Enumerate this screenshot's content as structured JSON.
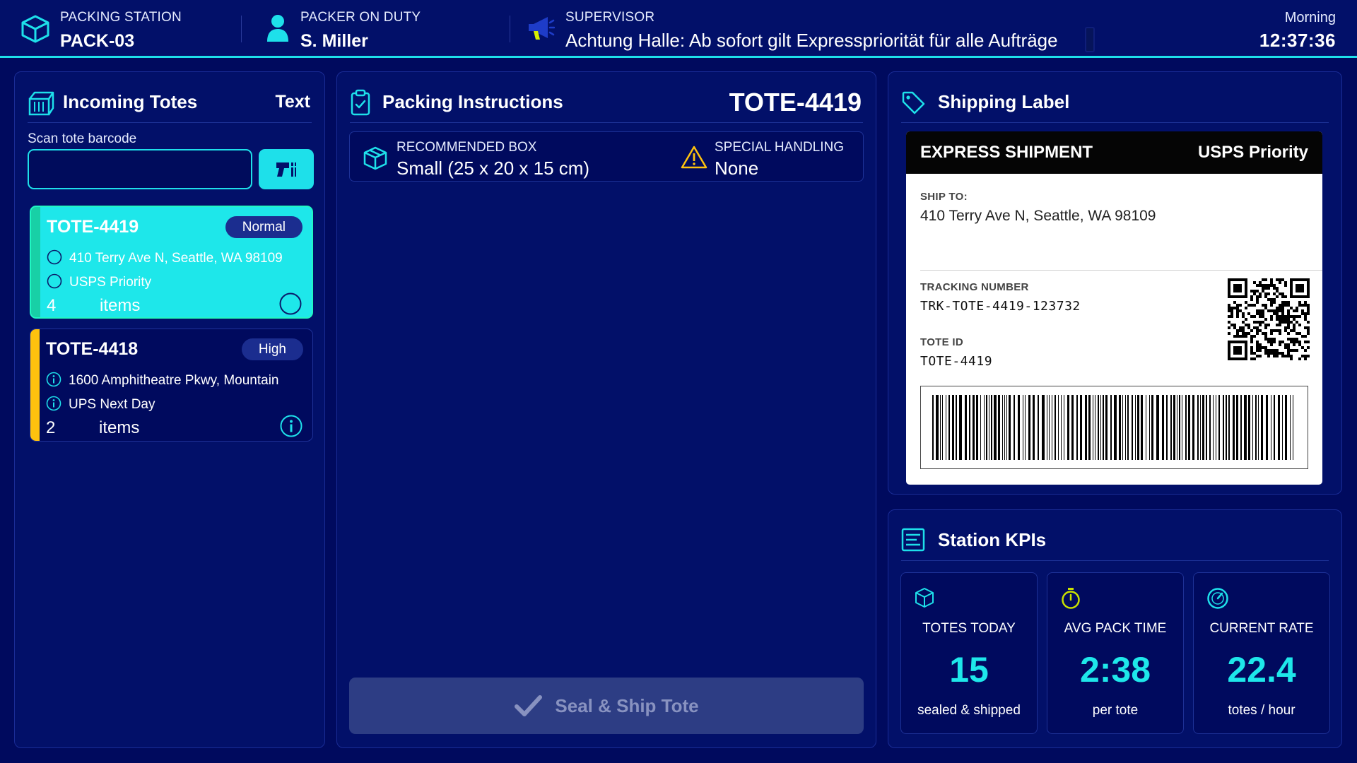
{
  "header": {
    "station": {
      "label": "PACKING STATION",
      "value": "PACK-03"
    },
    "packer": {
      "label": "PACKER ON DUTY",
      "value": "S. Miller"
    },
    "supervisor": {
      "label": "SUPERVISOR",
      "message": "Achtung Halle: Ab sofort gilt Expresspriorität für alle Aufträge"
    },
    "clock": {
      "label": "Morning",
      "time": "12:37:36"
    }
  },
  "incoming": {
    "title": "Incoming Totes",
    "head_right": "Text",
    "scan_label": "Scan tote barcode",
    "scan_value": "",
    "totes": [
      {
        "id": "TOTE-4419",
        "priority": "Normal",
        "address": "410 Terry Ave N, Seattle, WA 98109",
        "carrier": "USPS Priority",
        "count": "4",
        "count_label": "items"
      },
      {
        "id": "TOTE-4418",
        "priority": "High",
        "address": "1600 Amphitheatre Pkwy, Mountain",
        "carrier": "UPS Next Day",
        "count": "2",
        "count_label": "items"
      }
    ]
  },
  "instructions": {
    "title": "Packing Instructions",
    "tote_id": "TOTE-4419",
    "recommended_label": "RECOMMENDED BOX",
    "recommended_value": "Small (25 x 20 x 15 cm)",
    "special_label": "SPECIAL HANDLING",
    "special_value": "None",
    "seal_button": "Seal & Ship Tote"
  },
  "shipping": {
    "title": "Shipping Label",
    "service": "EXPRESS SHIPMENT",
    "carrier": "USPS Priority",
    "ship_to_label": "SHIP TO:",
    "ship_to": "410 Terry Ave N, Seattle, WA 98109",
    "tracking_label": "TRACKING NUMBER",
    "tracking": "TRK-TOTE-4419-123732",
    "tote_label": "TOTE ID",
    "tote_id": "TOTE-4419"
  },
  "kpis": {
    "title": "Station KPIs",
    "items": [
      {
        "label": "TOTES TODAY",
        "value": "15",
        "sub": "sealed & shipped",
        "icon": "box-icon"
      },
      {
        "label": "AVG PACK TIME",
        "value": "2:38",
        "sub": "per tote",
        "icon": "stopwatch-icon"
      },
      {
        "label": "CURRENT RATE",
        "value": "22.4",
        "sub": "totes / hour",
        "icon": "gauge-icon"
      }
    ]
  },
  "colors": {
    "background": "#000a5e",
    "panel": "#021069",
    "accent": "#1ee0ea",
    "priority_high": "#ffc20e",
    "warning": "#ffc20e",
    "timer": "#c8e000"
  }
}
